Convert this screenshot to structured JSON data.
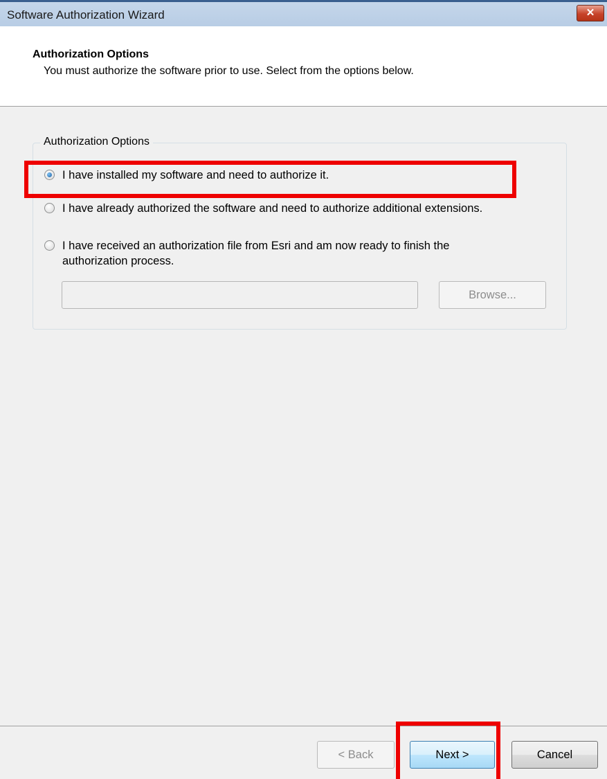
{
  "window": {
    "title": "Software Authorization Wizard",
    "close_symbol": "✕"
  },
  "header": {
    "title": "Authorization Options",
    "subtitle": "You must authorize the software prior to use. Select from the options below."
  },
  "group": {
    "legend": "Authorization Options",
    "options": [
      {
        "label": "I have installed my software and need to authorize it.",
        "checked": true
      },
      {
        "label": "I have already authorized the software and need to authorize additional extensions.",
        "checked": false
      },
      {
        "label_line1": "I have received an authorization file from Esri and am now ready to finish the",
        "label_line2": "authorization process.",
        "checked": false
      }
    ],
    "file_path": {
      "value": ""
    },
    "browse_label": "Browse..."
  },
  "footer": {
    "back_label": "< Back",
    "next_label": "Next >",
    "cancel_label": "Cancel"
  },
  "colors": {
    "highlight": "#ee0000",
    "titlebar": "#c5d6ea"
  }
}
